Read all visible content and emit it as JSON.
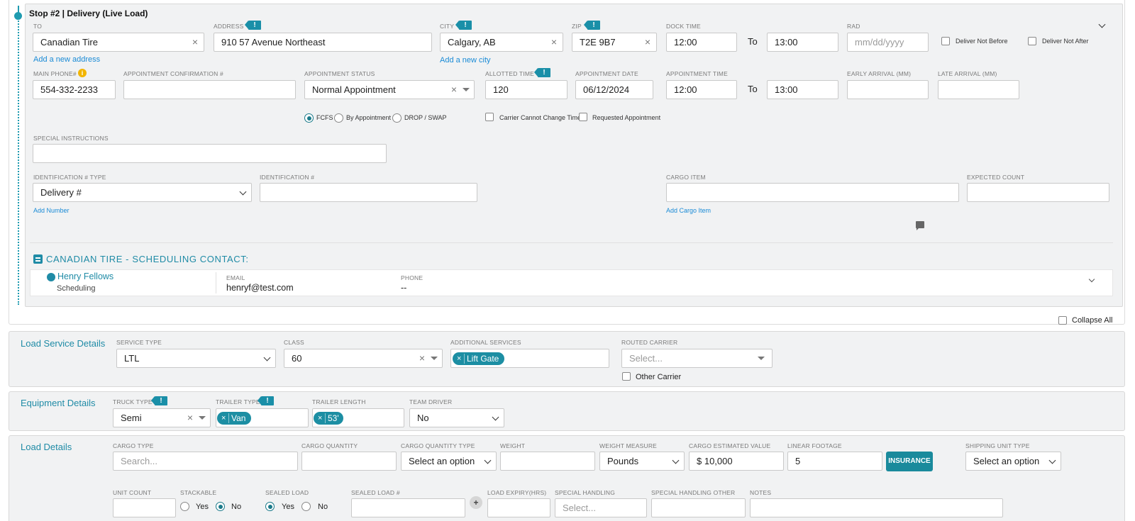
{
  "stop": {
    "title": "Stop #2 | Delivery (Live Load)",
    "to_label": "TO",
    "to_value": "Canadian Tire",
    "address_label": "ADDRESS",
    "address_value": "910 57 Avenue Northeast",
    "city_label": "CITY",
    "city_value": "Calgary, AB",
    "zip_label": "ZIP",
    "zip_value": "T2E 9B7",
    "dock_time_label": "DOCK TIME",
    "dock_time_from": "12:00",
    "to_word": "To",
    "dock_time_to": "13:00",
    "rad_label": "RAD",
    "rad_placeholder": "mm/dd/yyyy",
    "deliver_not_before": "Deliver Not Before",
    "deliver_not_after": "Deliver Not After",
    "add_address": "Add a new address",
    "add_city": "Add a new city",
    "main_phone_label": "MAIN PHONE#",
    "main_phone_value": "554-332-2233",
    "appt_conf_label": "APPOINTMENT CONFIRMATION #",
    "appt_status_label": "APPOINTMENT STATUS",
    "appt_status_value": "Normal Appointment",
    "allotted_time_label": "ALLOTTED TIME",
    "allotted_time_value": "120",
    "appt_date_label": "APPOINTMENT DATE",
    "appt_date_value": "06/12/2024",
    "appt_time_label": "APPOINTMENT TIME",
    "appt_time_from": "12:00",
    "appt_time_to": "13:00",
    "early_arrival_label": "EARLY ARRIVAL (MM)",
    "late_arrival_label": "LATE ARRIVAL (MM)",
    "radio_fcfs": "FCFS",
    "radio_by_appt": "By Appointment",
    "radio_drop": "DROP / SWAP",
    "carrier_cannot_change": "Carrier Cannot Change Time",
    "requested_appt": "Requested Appointment",
    "special_instructions_label": "SPECIAL INSTRUCTIONS",
    "id_type_label": "IDENTIFICATION # TYPE",
    "id_type_value": "Delivery #",
    "id_label": "IDENTIFICATION #",
    "add_number": "Add Number",
    "cargo_item_label": "CARGO ITEM",
    "add_cargo_item": "Add Cargo Item",
    "expected_count_label": "EXPECTED COUNT",
    "contact_header": "CANADIAN TIRE - SCHEDULING CONTACT:",
    "contact_name": "Henry Fellows",
    "contact_role": "Scheduling",
    "email_label": "EMAIL",
    "email_value": "henryf@test.com",
    "phone_label": "PHONE",
    "phone_value": "--"
  },
  "collapse_all": "Collapse All",
  "load_service": {
    "title": "Load Service Details",
    "service_type_label": "SERVICE TYPE",
    "service_type_value": "LTL",
    "class_label": "CLASS",
    "class_value": "60",
    "additional_services_label": "ADDITIONAL SERVICES",
    "additional_services_tag": "Lift Gate",
    "routed_carrier_label": "ROUTED CARRIER",
    "routed_carrier_placeholder": "Select...",
    "other_carrier": "Other Carrier"
  },
  "equipment": {
    "title": "Equipment Details",
    "truck_type_label": "TRUCK TYPE",
    "truck_type_value": "Semi",
    "trailer_type_label": "TRAILER TYPE",
    "trailer_type_tag": "Van",
    "trailer_length_label": "TRAILER LENGTH",
    "trailer_length_tag": "53'",
    "team_driver_label": "TEAM DRIVER",
    "team_driver_value": "No"
  },
  "load_details": {
    "title": "Load Details",
    "cargo_type_label": "CARGO TYPE",
    "cargo_type_placeholder": "Search...",
    "cargo_quantity_label": "CARGO QUANTITY",
    "cargo_quantity_type_label": "CARGO QUANTITY TYPE",
    "cargo_quantity_type_value": "Select an option",
    "weight_label": "WEIGHT",
    "weight_measure_label": "WEIGHT MEASURE",
    "weight_measure_value": "Pounds",
    "cargo_value_label": "CARGO ESTIMATED VALUE",
    "cargo_value_value": "$ 10,000",
    "linear_footage_label": "LINEAR FOOTAGE",
    "linear_footage_value": "5",
    "insurance_button": "INSURANCE",
    "shipping_unit_label": "SHIPPING UNIT TYPE",
    "shipping_unit_value": "Select an option",
    "unit_count_label": "UNIT COUNT",
    "stackable_label": "STACKABLE",
    "yes": "Yes",
    "no": "No",
    "sealed_load_label": "SEALED LOAD",
    "sealed_load_no_label": "SEALED LOAD #",
    "load_expiry_label": "LOAD EXPIRY(HRS)",
    "special_handling_label": "SPECIAL HANDLING",
    "special_handling_placeholder": "Select...",
    "special_handling_other_label": "SPECIAL HANDLING OTHER",
    "notes_label": "NOTES"
  }
}
